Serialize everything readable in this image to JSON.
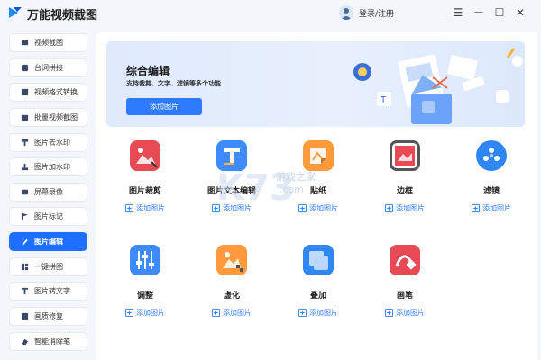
{
  "app": {
    "title": "万能视频截图",
    "login_label": "登录/注册"
  },
  "window_controls": {
    "menu": "☰",
    "minimize": "—",
    "maximize": "☐",
    "close": "✕"
  },
  "sidebar": {
    "items": [
      {
        "label": "视频截图",
        "icon": "film-icon"
      },
      {
        "label": "台词拼接",
        "icon": "subtitle-icon"
      },
      {
        "label": "视频格式转换",
        "icon": "convert-icon"
      },
      {
        "label": "批量视频截图",
        "icon": "batch-icon"
      },
      {
        "label": "图片去水印",
        "icon": "stamp-icon"
      },
      {
        "label": "图片加水印",
        "icon": "watermark-icon"
      },
      {
        "label": "屏幕录像",
        "icon": "record-icon"
      },
      {
        "label": "图片标记",
        "icon": "flag-icon"
      },
      {
        "label": "图片编辑",
        "icon": "pen-icon",
        "active": true
      },
      {
        "label": "一键拼图",
        "icon": "collage-icon"
      },
      {
        "label": "图片转文字",
        "icon": "text-icon"
      },
      {
        "label": "画质修复",
        "icon": "repair-icon"
      },
      {
        "label": "智能消除笔",
        "icon": "eraser-icon"
      }
    ]
  },
  "banner": {
    "title": "综合编辑",
    "subtitle": "支持裁剪、文字、滤镜等多个功能",
    "button_label": "添加图片"
  },
  "tools": [
    {
      "title": "图片裁剪",
      "add_label": "添加图片",
      "icon": "crop-icon",
      "color": "#e84a55"
    },
    {
      "title": "图片文本编辑",
      "add_label": "添加图片",
      "icon": "text-edit-icon",
      "color": "#3d8bff"
    },
    {
      "title": "贴纸",
      "add_label": "添加图片",
      "icon": "sticker-icon",
      "color": "#ff9a3c"
    },
    {
      "title": "边框",
      "add_label": "添加图片",
      "icon": "border-icon",
      "color": "#e84a55"
    },
    {
      "title": "滤镜",
      "add_label": "添加图片",
      "icon": "filter-icon",
      "color": "#2f86f5"
    },
    {
      "title": "调整",
      "add_label": "添加图片",
      "icon": "adjust-icon",
      "color": "#3d8bff"
    },
    {
      "title": "虚化",
      "add_label": "添加图片",
      "icon": "blur-icon",
      "color": "#ff9a3c"
    },
    {
      "title": "叠加",
      "add_label": "添加图片",
      "icon": "overlay-icon",
      "color": "#2f86f5"
    },
    {
      "title": "画笔",
      "add_label": "添加图片",
      "icon": "brush-icon",
      "color": "#e84a55"
    }
  ],
  "watermark": {
    "text": "游戏之家",
    "domain": ".com"
  },
  "colors": {
    "accent": "#1f6fff",
    "background": "#f3f6fb",
    "card": "#ffffff"
  }
}
